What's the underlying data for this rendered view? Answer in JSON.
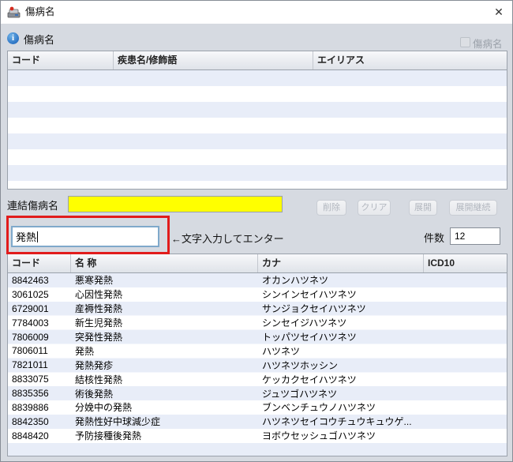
{
  "window": {
    "title": "傷病名"
  },
  "icons": {
    "close": "✕",
    "info": "i",
    "app": "app-logo"
  },
  "panel": {
    "info_label": "傷病名",
    "checkbox_label": "傷病名"
  },
  "top_table": {
    "columns": [
      "コード",
      "疾患名/修飾語",
      "エイリアス"
    ]
  },
  "linked_field": {
    "label": "連結傷病名",
    "value": ""
  },
  "action_buttons": [
    {
      "label": "削除"
    },
    {
      "label": "クリア"
    },
    {
      "label": "展開"
    },
    {
      "label": "展開継続"
    }
  ],
  "search": {
    "value": "発熱",
    "hint": "←文字入力してエンター"
  },
  "count": {
    "label": "件数",
    "value": "12"
  },
  "result_table": {
    "columns": [
      "コード",
      "名 称",
      "カナ",
      "ICD10"
    ],
    "rows": [
      [
        "8842463",
        "悪寒発熱",
        "オカンハツネツ",
        ""
      ],
      [
        "3061025",
        "心因性発熱",
        "シンインセイハツネツ",
        ""
      ],
      [
        "6729001",
        "産褥性発熱",
        "サンジョクセイハツネツ",
        ""
      ],
      [
        "7784003",
        "新生児発熱",
        "シンセイジハツネツ",
        ""
      ],
      [
        "7806009",
        "突発性発熱",
        "トッパツセイハツネツ",
        ""
      ],
      [
        "7806011",
        "発熱",
        "ハツネツ",
        ""
      ],
      [
        "7821011",
        "発熱発疹",
        "ハツネツホッシン",
        ""
      ],
      [
        "8833075",
        "結核性発熱",
        "ケッカクセイハツネツ",
        ""
      ],
      [
        "8835356",
        "術後発熱",
        "ジュツゴハツネツ",
        ""
      ],
      [
        "8839886",
        "分娩中の発熱",
        "ブンベンチュウノハツネツ",
        ""
      ],
      [
        "8842350",
        "発熱性好中球減少症",
        "ハツネツセイコウチュウキュウゲ...",
        ""
      ],
      [
        "8848420",
        "予防接種後発熱",
        "ヨボウセッシュゴハツネツ",
        ""
      ]
    ]
  },
  "colors": {
    "highlight_yellow": "#ffff00",
    "annotation_red": "#e11c1c",
    "row_stripe": "#e8edf8",
    "focus_blue": "#7fa9cb"
  }
}
